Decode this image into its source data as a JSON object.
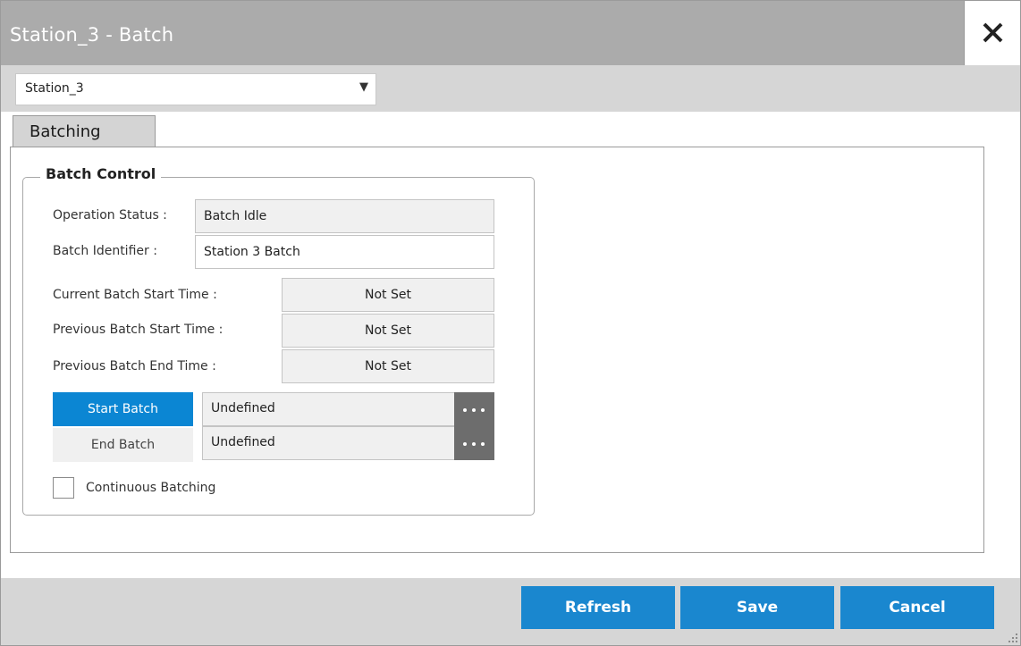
{
  "window": {
    "title": "Station_3 - Batch"
  },
  "selector": {
    "value": "Station_3"
  },
  "tabs": [
    {
      "label": "Batching"
    }
  ],
  "batch_control": {
    "legend": "Batch Control",
    "operation_status": {
      "label": "Operation Status :",
      "value": "Batch Idle"
    },
    "batch_identifier": {
      "label": "Batch Identifier :",
      "value": "Station 3 Batch"
    },
    "current_start": {
      "label": "Current Batch Start Time :",
      "value": "Not Set"
    },
    "previous_start": {
      "label": "Previous Batch Start Time :",
      "value": "Not Set"
    },
    "previous_end": {
      "label": "Previous Batch End Time :",
      "value": "Not Set"
    },
    "start_batch": {
      "label": "Start Batch",
      "value": "Undefined"
    },
    "end_batch": {
      "label": "End Batch",
      "value": "Undefined"
    },
    "continuous": {
      "label": "Continuous Batching",
      "checked": false
    }
  },
  "footer": {
    "refresh": "Refresh",
    "save": "Save",
    "cancel": "Cancel"
  },
  "colors": {
    "accent": "#0b86d3",
    "title_bar": "#ababab",
    "strip": "#d6d6d6",
    "ellipsis_button": "#6d6d6d"
  },
  "icons": {
    "close": "close-icon",
    "dropdown": "chevron-down-icon",
    "more": "ellipsis-icon",
    "resize": "resize-grip-icon"
  }
}
